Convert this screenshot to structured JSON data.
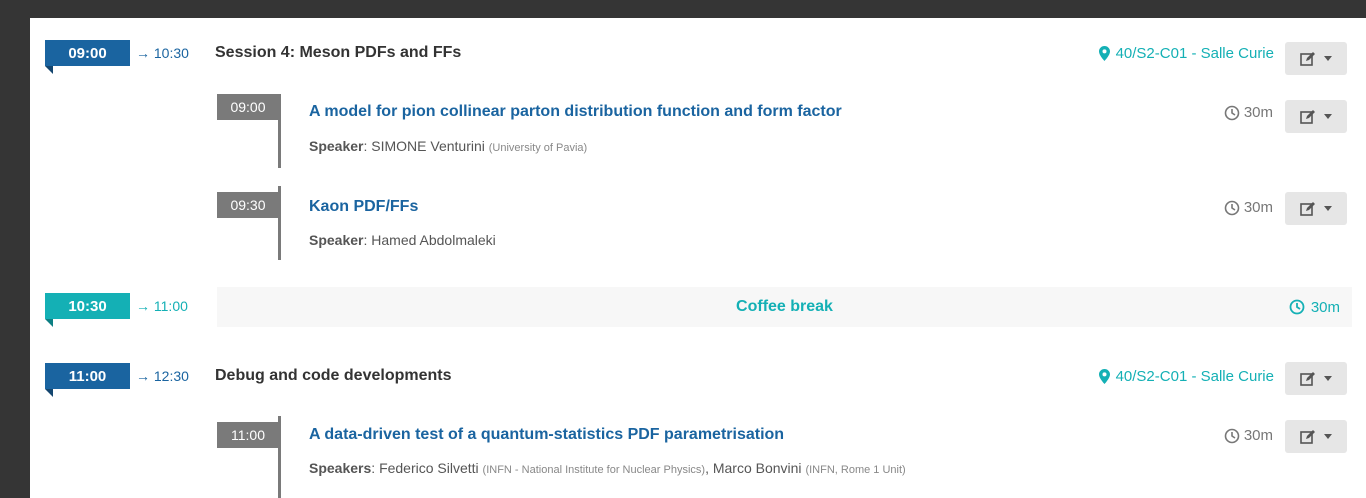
{
  "sessions": [
    {
      "start": "09:00",
      "end": "→ 10:30",
      "title": "Session 4: Meson PDFs and FFs",
      "location": "40/S2-C01 - Salle Curie"
    },
    {
      "start": "11:00",
      "end": "→ 12:30",
      "title": "Debug and code developments",
      "location": "40/S2-C01 - Salle Curie"
    }
  ],
  "contributions": [
    {
      "time": "09:00",
      "title": "A model for pion collinear parton distribution function and form factor",
      "speaker_label": "Speaker",
      "speakers": "SIMONE Venturini",
      "affiliation": "(University of Pavia)",
      "duration": "30m"
    },
    {
      "time": "09:30",
      "title": "Kaon PDF/FFs",
      "speaker_label": "Speaker",
      "speakers": "Hamed Abdolmaleki",
      "affiliation": "",
      "duration": "30m"
    },
    {
      "time": "11:00",
      "title": "A data-driven test of a quantum-statistics PDF parametrisation",
      "speaker_label": "Speakers",
      "speaker1": "Federico Silvetti",
      "aff1": "(INFN - National Institute for Nuclear Physics)",
      "speaker2": "Marco Bonvini",
      "aff2": "(INFN, Rome 1 Unit)",
      "duration": "30m"
    }
  ],
  "break": {
    "start": "10:30",
    "end": "→ 11:00",
    "title": "Coffee break",
    "duration": "30m"
  },
  "icons": {
    "location": "map-marker-icon",
    "clock": "clock-icon",
    "edit": "edit-icon",
    "caret": "chevron-down-icon"
  },
  "colors": {
    "blue": "#1a64a0",
    "teal": "#14b0b5",
    "gray": "#7a7a7a"
  }
}
